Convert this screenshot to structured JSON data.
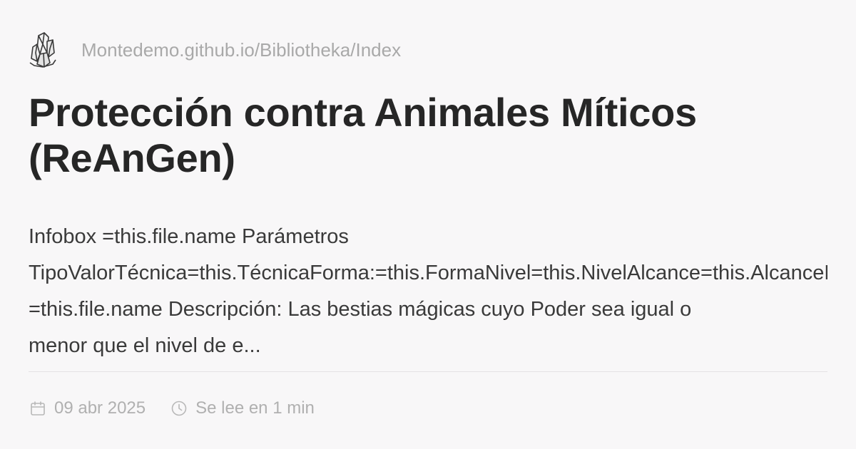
{
  "site": {
    "logo_icon": "crystal-cluster-icon",
    "url": "Montedemo.github.io/Bibliotheka/Index"
  },
  "article": {
    "title": "Protección contra Animales Míticos\n(ReAnGen)",
    "description_lines": [
      "Infobox =this.file.name Parámetros",
      "TipoValorTécnica=this.TécnicaForma:=this.FormaNivel=this.NivelAlcance=this.AlcanceDuración=this.DuraciónObjetivo=this.Objetivo",
      "=this.file.name Descripción: Las bestias mágicas cuyo Poder sea igual o",
      "menor que el nivel de e..."
    ]
  },
  "meta": {
    "date_icon": "calendar-icon",
    "date": "09 abr 2025",
    "reading_icon": "clock-icon",
    "reading_time": "Se lee en 1 min"
  },
  "colors": {
    "background": "#f8f7f8",
    "title": "#262626",
    "muted": "#a9a9a9"
  }
}
